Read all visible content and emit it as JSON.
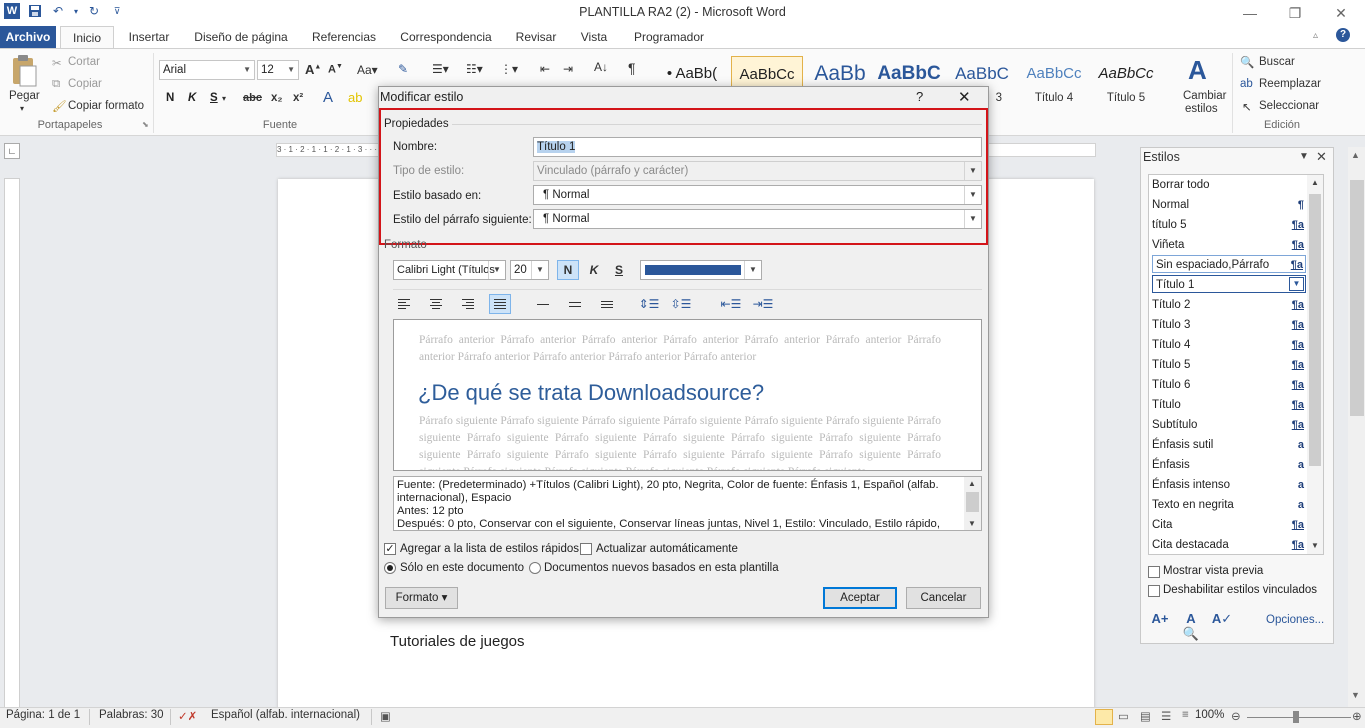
{
  "window": {
    "title": "PLANTILLA RA2 (2)  -  Microsoft Word",
    "min": "—",
    "restore": "❐",
    "close": "✕"
  },
  "ribbon_tabs": [
    "Archivo",
    "Inicio",
    "Insertar",
    "Diseño de página",
    "Referencias",
    "Correspondencia",
    "Revisar",
    "Vista",
    "Programador"
  ],
  "clipboard": {
    "paste": "Pegar",
    "cut": "Cortar",
    "copy": "Copiar",
    "format_painter": "Copiar formato",
    "group": "Portapapeles"
  },
  "font": {
    "family": "Arial",
    "size": "12",
    "group": "Fuente",
    "bold": "N",
    "italic": "K",
    "underline": "S",
    "strike": "abc",
    "sub": "x₂",
    "sup": "x²"
  },
  "paragraph": {
    "pilcrow": "¶"
  },
  "styles_gallery": [
    {
      "sample": "• AaBb(",
      "name": ""
    },
    {
      "sample": "AaBbCc",
      "name": ""
    },
    {
      "sample": "AaBb",
      "name": ""
    },
    {
      "sample": "AaBbC",
      "name": ""
    },
    {
      "sample": "AaBbC",
      "name": "3"
    },
    {
      "sample": "AaBbCc",
      "name": "Título 4"
    },
    {
      "sample": "AaBbCc",
      "name": "Título 5"
    }
  ],
  "change_styles": {
    "line1": "Cambiar",
    "line2": "estilos"
  },
  "editing": {
    "find": "Buscar",
    "replace": "Reemplazar",
    "select": "Seleccionar",
    "group": "Edición"
  },
  "ruler_numbers": "3 · 1 · 2 · 1 · 1 · 2 · 1 · 3 · · · · · · · · · · · · · · · · · · · · · · · 16 · 1 · 17 · 1 · 18 · 1",
  "document": {
    "body_text": "Tutoriales de juegos"
  },
  "dialog": {
    "title": "Modificar estilo",
    "help": "?",
    "close": "✕",
    "properties_label": "Propiedades",
    "name_label": "Nombre:",
    "name_value": "Título 1",
    "type_label": "Tipo de estilo:",
    "type_value": "Vinculado (párrafo y carácter)",
    "based_label": "Estilo basado en:",
    "based_value": "¶  Normal",
    "next_label": "Estilo del párrafo siguiente:",
    "next_value": "¶  Normal",
    "format_label": "Formato",
    "font_value": "Calibri Light (Títulos",
    "size_value": "20",
    "bold": "N",
    "italic": "K",
    "underline": "S",
    "font_color": "#2b579a",
    "preview_prev": "Párrafo anterior Párrafo anterior Párrafo anterior Párrafo anterior Párrafo anterior Párrafo anterior Párrafo anterior Párrafo anterior Párrafo anterior Párrafo anterior Párrafo anterior",
    "preview_heading": "¿De qué se trata Downloadsource?",
    "preview_next": "Párrafo siguiente Párrafo siguiente Párrafo siguiente Párrafo siguiente Párrafo siguiente Párrafo siguiente Párrafo siguiente Párrafo siguiente Párrafo siguiente Párrafo siguiente Párrafo siguiente Párrafo siguiente Párrafo siguiente Párrafo siguiente Párrafo siguiente Párrafo siguiente Párrafo siguiente Párrafo siguiente Párrafo siguiente Párrafo siguiente Párrafo siguiente Párrafo siguiente Párrafo siguiente Párrafo siguiente",
    "desc_line1": "Fuente: (Predeterminado) +Títulos (Calibri Light), 20 pto, Negrita, Color de fuente: Énfasis 1, Español (alfab.",
    "desc_line2": "internacional), Espacio",
    "desc_line3": "    Antes:  12 pto",
    "desc_line4": "    Después:  0 pto, Conservar con el siguiente, Conservar líneas juntas, Nivel 1, Estilo: Vinculado, Estilo rápido,",
    "quick_list": "Agregar a la lista de estilos rápidos",
    "auto_update": "Actualizar automáticamente",
    "only_doc": "Sólo en este documento",
    "new_docs": "Documentos nuevos basados en esta plantilla",
    "format_button": "Formato ▾",
    "ok": "Aceptar",
    "cancel": "Cancelar"
  },
  "styles_pane": {
    "title": "Estilos",
    "items": [
      {
        "name": "Borrar todo",
        "mark": ""
      },
      {
        "name": "Normal",
        "mark": "¶"
      },
      {
        "name": "título 5",
        "mark": "¶a"
      },
      {
        "name": "Viñeta",
        "mark": "¶a"
      },
      {
        "name": "Sin espaciado,Párrafo",
        "mark": "¶a"
      },
      {
        "name": "Título 1",
        "mark": ""
      },
      {
        "name": "Título 2",
        "mark": "¶a"
      },
      {
        "name": "Título 3",
        "mark": "¶a"
      },
      {
        "name": "Título 4",
        "mark": "¶a"
      },
      {
        "name": "Título 5",
        "mark": "¶a"
      },
      {
        "name": "Título 6",
        "mark": "¶a"
      },
      {
        "name": "Título",
        "mark": "¶a"
      },
      {
        "name": "Subtítulo",
        "mark": "¶a"
      },
      {
        "name": "Énfasis sutil",
        "mark": "a"
      },
      {
        "name": "Énfasis",
        "mark": "a"
      },
      {
        "name": "Énfasis intenso",
        "mark": "a"
      },
      {
        "name": "Texto en negrita",
        "mark": "a"
      },
      {
        "name": "Cita",
        "mark": "¶a"
      },
      {
        "name": "Cita destacada",
        "mark": "¶a"
      }
    ],
    "show_preview": "Mostrar vista previa",
    "disable_linked": "Deshabilitar estilos vinculados",
    "options": "Opciones..."
  },
  "status": {
    "page": "Página: 1 de 1",
    "words": "Palabras: 30",
    "language": "Español (alfab. internacional)",
    "zoom": "100%"
  }
}
